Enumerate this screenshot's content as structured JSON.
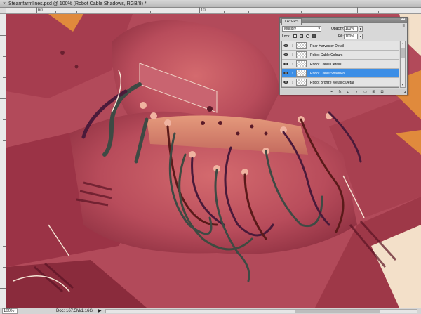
{
  "window": {
    "title": "Steamfarmlines.psd @ 100% (Robot Cable Shadows, RGB/8) *",
    "close_glyph": "×"
  },
  "rulers": {
    "h_labels": [
      "60",
      "",
      "",
      "",
      "",
      "",
      "10",
      "",
      "",
      "",
      ""
    ],
    "h_visible": [
      {
        "label": "60",
        "x": 0
      },
      {
        "label": "10",
        "x": 0
      }
    ]
  },
  "status": {
    "zoom": "100%",
    "doc_info": "Doc: 167.5M/1.16G",
    "arrow": "▶"
  },
  "layers_panel": {
    "tab_label": "LAYERS",
    "menu_glyph": "≡",
    "collapse_glyph": "◂◂",
    "blend_mode": "Multiply",
    "opacity_label": "Opacity:",
    "opacity_value": "100%",
    "lock_label": "Lock:",
    "fill_label": "Fill:",
    "fill_value": "100%",
    "layers": [
      {
        "name": "Rear Harvester Detail",
        "selected": false
      },
      {
        "name": "Robot Cable Colours",
        "selected": false
      },
      {
        "name": "Robot Cable Details",
        "selected": false
      },
      {
        "name": "Robot Cable Shadows",
        "selected": true
      },
      {
        "name": "Robot Bronze Metallic Detail",
        "selected": false
      }
    ],
    "footer_icons": [
      "link-icon",
      "fx-icon",
      "mask-icon",
      "adjustment-icon",
      "folder-icon",
      "new-layer-icon",
      "trash-icon"
    ],
    "footer_glyphs": [
      "⚭",
      "fx",
      "◘",
      "◐",
      "▭",
      "⊞",
      "⊠"
    ]
  },
  "colors": {
    "canvas_base": "#b24a5a",
    "selection_blue": "#3c8ee6"
  }
}
